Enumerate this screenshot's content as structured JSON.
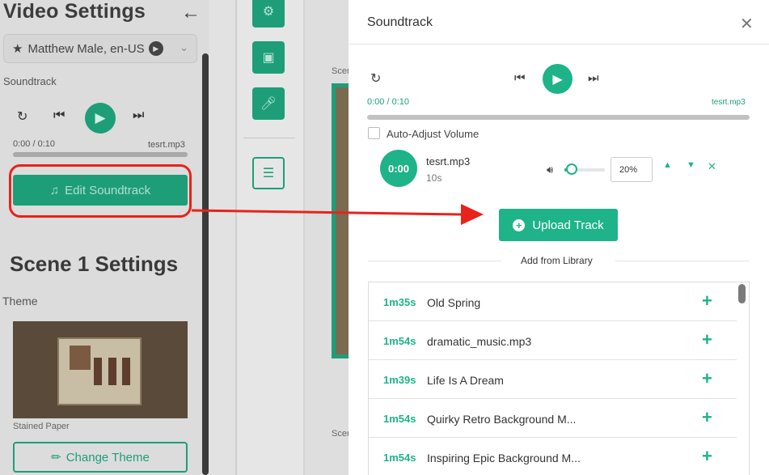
{
  "left": {
    "title": "Video Settings",
    "voice": "Matthew Male, en-US",
    "soundtrack_label": "Soundtrack",
    "time": "0:00 / 0:10",
    "file": "tesrt.mp3",
    "edit_label": "Edit Soundtrack",
    "scene_title": "Scene 1 Settings",
    "theme_label": "Theme",
    "theme_name": "Stained Paper",
    "change_theme_label": "Change Theme"
  },
  "preview": {
    "scene_label_top": "Scen",
    "scene_label_bottom": "Scen"
  },
  "modal": {
    "title": "Soundtrack",
    "time": "0:00 / 0:10",
    "file": "tesrt.mp3",
    "auto_adjust_label": "Auto-Adjust Volume",
    "track": {
      "start": "0:00",
      "name": "tesrt.mp3",
      "length": "10s",
      "volume": "20%",
      "volume_fraction": 0.2
    },
    "upload_label": "Upload Track",
    "library_label": "Add from Library",
    "library": [
      {
        "duration": "1m35s",
        "name": "Old Spring"
      },
      {
        "duration": "1m54s",
        "name": "dramatic_music.mp3"
      },
      {
        "duration": "1m39s",
        "name": "Life Is A Dream"
      },
      {
        "duration": "1m54s",
        "name": "Quirky Retro Background M..."
      },
      {
        "duration": "1m54s",
        "name": "Inspiring Epic Background M..."
      }
    ]
  },
  "colors": {
    "accent": "#1eb389",
    "annotation": "#e8231b"
  }
}
